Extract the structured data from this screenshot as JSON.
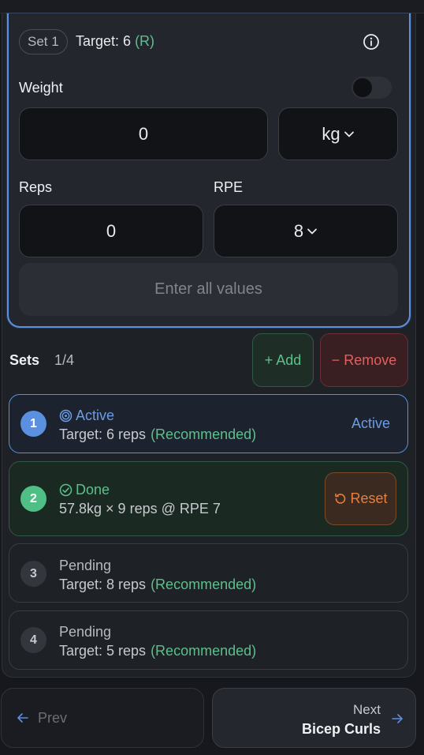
{
  "card": {
    "set_chip": "Set 1",
    "target_text": "Target: 6",
    "target_rec": "(R)",
    "weight_label": "Weight",
    "weight_value": "0",
    "unit": "kg",
    "reps_label": "Reps",
    "reps_value": "0",
    "rpe_label": "RPE",
    "rpe_value": "8",
    "enter_button": "Enter all values"
  },
  "sets": {
    "title": "Sets",
    "count": "1/4",
    "add_label": "+ Add",
    "remove_label": "− Remove",
    "rows": [
      {
        "num": "1",
        "status": "Active",
        "sub": "Target: 6 reps",
        "rec": "(Recommended)",
        "tag": "Active"
      },
      {
        "num": "2",
        "status": "Done",
        "sub": "57.8kg × 9 reps @ RPE 7",
        "action": "Reset"
      },
      {
        "num": "3",
        "status": "Pending",
        "sub": "Target: 8 reps",
        "rec": "(Recommended)"
      },
      {
        "num": "4",
        "status": "Pending",
        "sub": "Target: 5 reps",
        "rec": "(Recommended)"
      }
    ]
  },
  "nav": {
    "prev_label": "Prev",
    "next_small": "Next",
    "next_name": "Bicep Curls"
  },
  "colors": {
    "accent_blue": "#5b8fe0",
    "success_green": "#5cc08a",
    "danger_red": "#e0605e",
    "reset_orange": "#e77f3f"
  },
  "icons": [
    "info-icon",
    "chevron-down-icon",
    "target-icon",
    "check-circle-icon",
    "reset-icon",
    "arrow-left-icon",
    "arrow-right-icon"
  ]
}
